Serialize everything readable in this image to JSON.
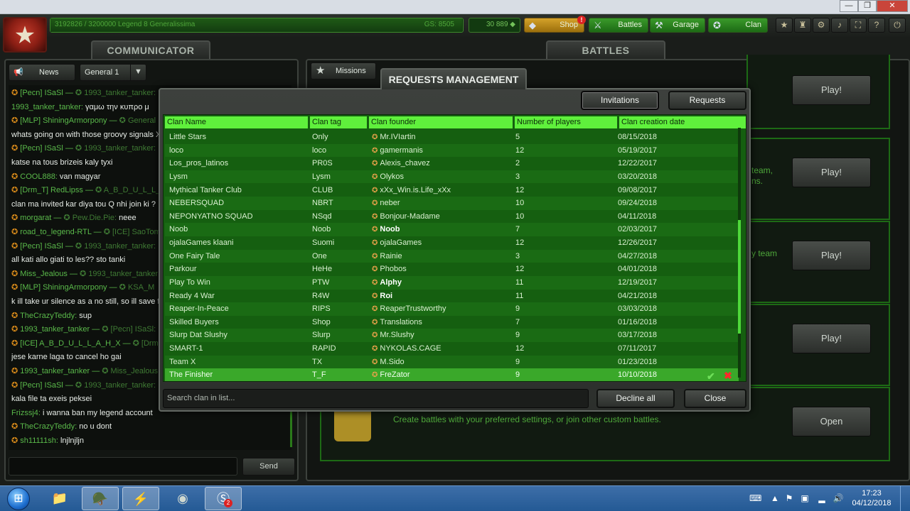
{
  "window": {
    "minimize": "—",
    "maximize": "❐",
    "close": "✕"
  },
  "topbar": {
    "xp": "3192826 / 3200000   Legend 8 Generalissima",
    "xp_progress": 0.998,
    "gs": "GS: 8505",
    "crystals": "30 889",
    "shop_label": "Shop",
    "shop_badge": "!",
    "battles_label": "Battles",
    "garage_label": "Garage",
    "clan_label": "Clan"
  },
  "communicator": {
    "title": "COMMUNICATOR",
    "news_label": "News",
    "channel_label": "General 1",
    "send_label": "Send",
    "messages": [
      {
        "icon": "✪",
        "name": "[Pecn] ISaSl —",
        "dim": "  ✪ 1993_tanker_tanker:",
        "text": ""
      },
      {
        "icon": "",
        "name": "1993_tanker_tanker:",
        "dim": "",
        "text": " γαμω την κυπρο μ"
      },
      {
        "icon": "✪",
        "name": "[MLP] ShiningArmorpony —",
        "dim": " ✪ General",
        "text": ""
      },
      {
        "icon": "",
        "name": "",
        "dim": "",
        "text": "whats going on with those groovy signals XD"
      },
      {
        "icon": "✪",
        "name": "[Pecn] ISaSl —",
        "dim": "  ✪ 1993_tanker_tanker:",
        "text": ""
      },
      {
        "icon": "",
        "name": "",
        "dim": "",
        "text": "katse na tous brizeis kaly tyxi"
      },
      {
        "icon": "✪",
        "name": "COOL888:",
        "dim": "",
        "text": " van magyar"
      },
      {
        "icon": "✪",
        "name": "[Drm_T] RedLipss —",
        "dim": " ✪ A_B_D_U_L_L_",
        "text": ""
      },
      {
        "icon": "",
        "name": "",
        "dim": "",
        "text": "clan ma invited kar diya tou Q nhi join ki ?"
      },
      {
        "icon": "✪",
        "name": "morgarat —",
        "dim": " ✪ Pew.Die.Pie:",
        "text": " neee"
      },
      {
        "icon": "✪",
        "name": "road_to_legend-RTL —",
        "dim": " ✪ [ICE] SaoTom",
        "text": ""
      },
      {
        "icon": "✪",
        "name": "[Pecn] ISaSl —",
        "dim": "  ✪ 1993_tanker_tanker:",
        "text": ""
      },
      {
        "icon": "",
        "name": "",
        "dim": "",
        "text": "all kati allo giati to les?? sto tanki"
      },
      {
        "icon": "✪",
        "name": "Miss_Jealous —",
        "dim": "  ✪ 1993_tanker_tanker",
        "text": ""
      },
      {
        "icon": "✪",
        "name": "[MLP] ShiningArmorpony —",
        "dim": " ✪ KSA_M",
        "text": ""
      },
      {
        "icon": "",
        "name": "",
        "dim": "",
        "text": "k ill take ur silence as a no still, so ill save for"
      },
      {
        "icon": "✪",
        "name": "TheCrazyTeddy:",
        "dim": "",
        "text": " sup"
      },
      {
        "icon": "✪",
        "name": "1993_tanker_tanker —",
        "dim": "  ✪ [Pecn] ISaSl:",
        "text": ""
      },
      {
        "icon": "✪",
        "name": "[ICE] A_B_D_U_L_L_A_H_X —",
        "dim": " ✪ [Drm_",
        "text": ""
      },
      {
        "icon": "",
        "name": "",
        "dim": "",
        "text": "jese karne laga to cancel ho gai"
      },
      {
        "icon": "✪",
        "name": "1993_tanker_tanker —",
        "dim": "  ✪ Miss_Jealous",
        "text": ""
      },
      {
        "icon": "✪",
        "name": "[Pecn] ISaSl —",
        "dim": "  ✪ 1993_tanker_tanker:",
        "text": ""
      },
      {
        "icon": "",
        "name": "",
        "dim": "",
        "text": "kala file ta exeis peksei"
      },
      {
        "icon": "",
        "name": "Frizssj4:",
        "dim": "",
        "text": " i wanna ban my legend account"
      },
      {
        "icon": "✪",
        "name": "TheCrazyTeddy:",
        "dim": "",
        "text": " no u dont"
      },
      {
        "icon": "✪",
        "name": "sh11111sh:",
        "dim": "",
        "text": " lnjlnjljn"
      }
    ]
  },
  "battles": {
    "title": "BATTLES",
    "missions_label": "Missions",
    "play_label": "Play!",
    "open_label": "Open",
    "behind_texts": [
      "team,",
      "ns.",
      "y team",
      "Create battles with your preferred settings, or join other custom battles."
    ]
  },
  "modal": {
    "title": "REQUESTS MANAGEMENT",
    "invitations_label": "Invitations",
    "requests_label": "Requests",
    "columns": [
      "Clan Name",
      "Clan tag",
      "Clan founder",
      "Number of players",
      "Clan creation date"
    ],
    "rows": [
      {
        "name": "Little Stars",
        "tag": "Only",
        "founder": "Mr.IVIartin",
        "players": "5",
        "date": "08/15/2018"
      },
      {
        "name": "loco",
        "tag": "loco",
        "founder": "gamermanis",
        "players": "12",
        "date": "05/19/2017"
      },
      {
        "name": "Los_pros_latinos",
        "tag": "PR0S",
        "founder": "Alexis_chavez",
        "players": "2",
        "date": "12/22/2017"
      },
      {
        "name": "Lysm",
        "tag": "Lysm",
        "founder": "Olykos",
        "players": "3",
        "date": "03/20/2018"
      },
      {
        "name": "Mythical Tanker Club",
        "tag": "CLUB",
        "founder": "xXx_Win.is.Life_xXx",
        "players": "12",
        "date": "09/08/2017"
      },
      {
        "name": "NEBERSQUAD",
        "tag": "NBRT",
        "founder": "neber",
        "players": "10",
        "date": "09/24/2018"
      },
      {
        "name": "NEPONYATNO SQUAD",
        "tag": "NSqd",
        "founder": "Bonjour-Madame",
        "players": "10",
        "date": "04/11/2018"
      },
      {
        "name": "Noob",
        "tag": "Noob",
        "founder": "Noob",
        "players": "7",
        "date": "02/03/2017"
      },
      {
        "name": "ojalaGames klaani",
        "tag": "Suomi",
        "founder": "ojalaGames",
        "players": "12",
        "date": "12/26/2017"
      },
      {
        "name": "One Fairy Tale",
        "tag": "One",
        "founder": "Rainie",
        "players": "3",
        "date": "04/27/2018"
      },
      {
        "name": "Parkour",
        "tag": "HeHe",
        "founder": "Phobos",
        "players": "12",
        "date": "04/01/2018"
      },
      {
        "name": "Play To Win",
        "tag": "PTW",
        "founder": "Alphy",
        "players": "11",
        "date": "12/19/2017"
      },
      {
        "name": "Ready 4 War",
        "tag": "R4W",
        "founder": "Roi",
        "players": "11",
        "date": "04/21/2018"
      },
      {
        "name": "Reaper-In-Peace",
        "tag": "RIPS",
        "founder": "ReaperTrustworthy",
        "players": "9",
        "date": "03/03/2018"
      },
      {
        "name": "Skilled Buyers",
        "tag": "Shop",
        "founder": "Translations",
        "players": "7",
        "date": "01/16/2018"
      },
      {
        "name": "Slurp Dat Slushy",
        "tag": "Slurp",
        "founder": "Mr.Slushy",
        "players": "9",
        "date": "03/17/2018"
      },
      {
        "name": "SMART-1",
        "tag": "RAPID",
        "founder": "NYKOLAS.CAGE",
        "players": "12",
        "date": "07/11/2017"
      },
      {
        "name": "Team X",
        "tag": "TX",
        "founder": "M.Sido",
        "players": "9",
        "date": "01/23/2018"
      },
      {
        "name": "The Finisher",
        "tag": "T_F",
        "founder": "FreZator",
        "players": "9",
        "date": "10/10/2018"
      }
    ],
    "bold_founders": [
      "Noob",
      "Alphy",
      "Roi"
    ],
    "search_placeholder": "Search clan in list...",
    "decline_all_label": "Decline all",
    "close_label": "Close"
  },
  "taskbar": {
    "time": "17:23",
    "date": "04/12/2018",
    "skype_badge": "2"
  }
}
